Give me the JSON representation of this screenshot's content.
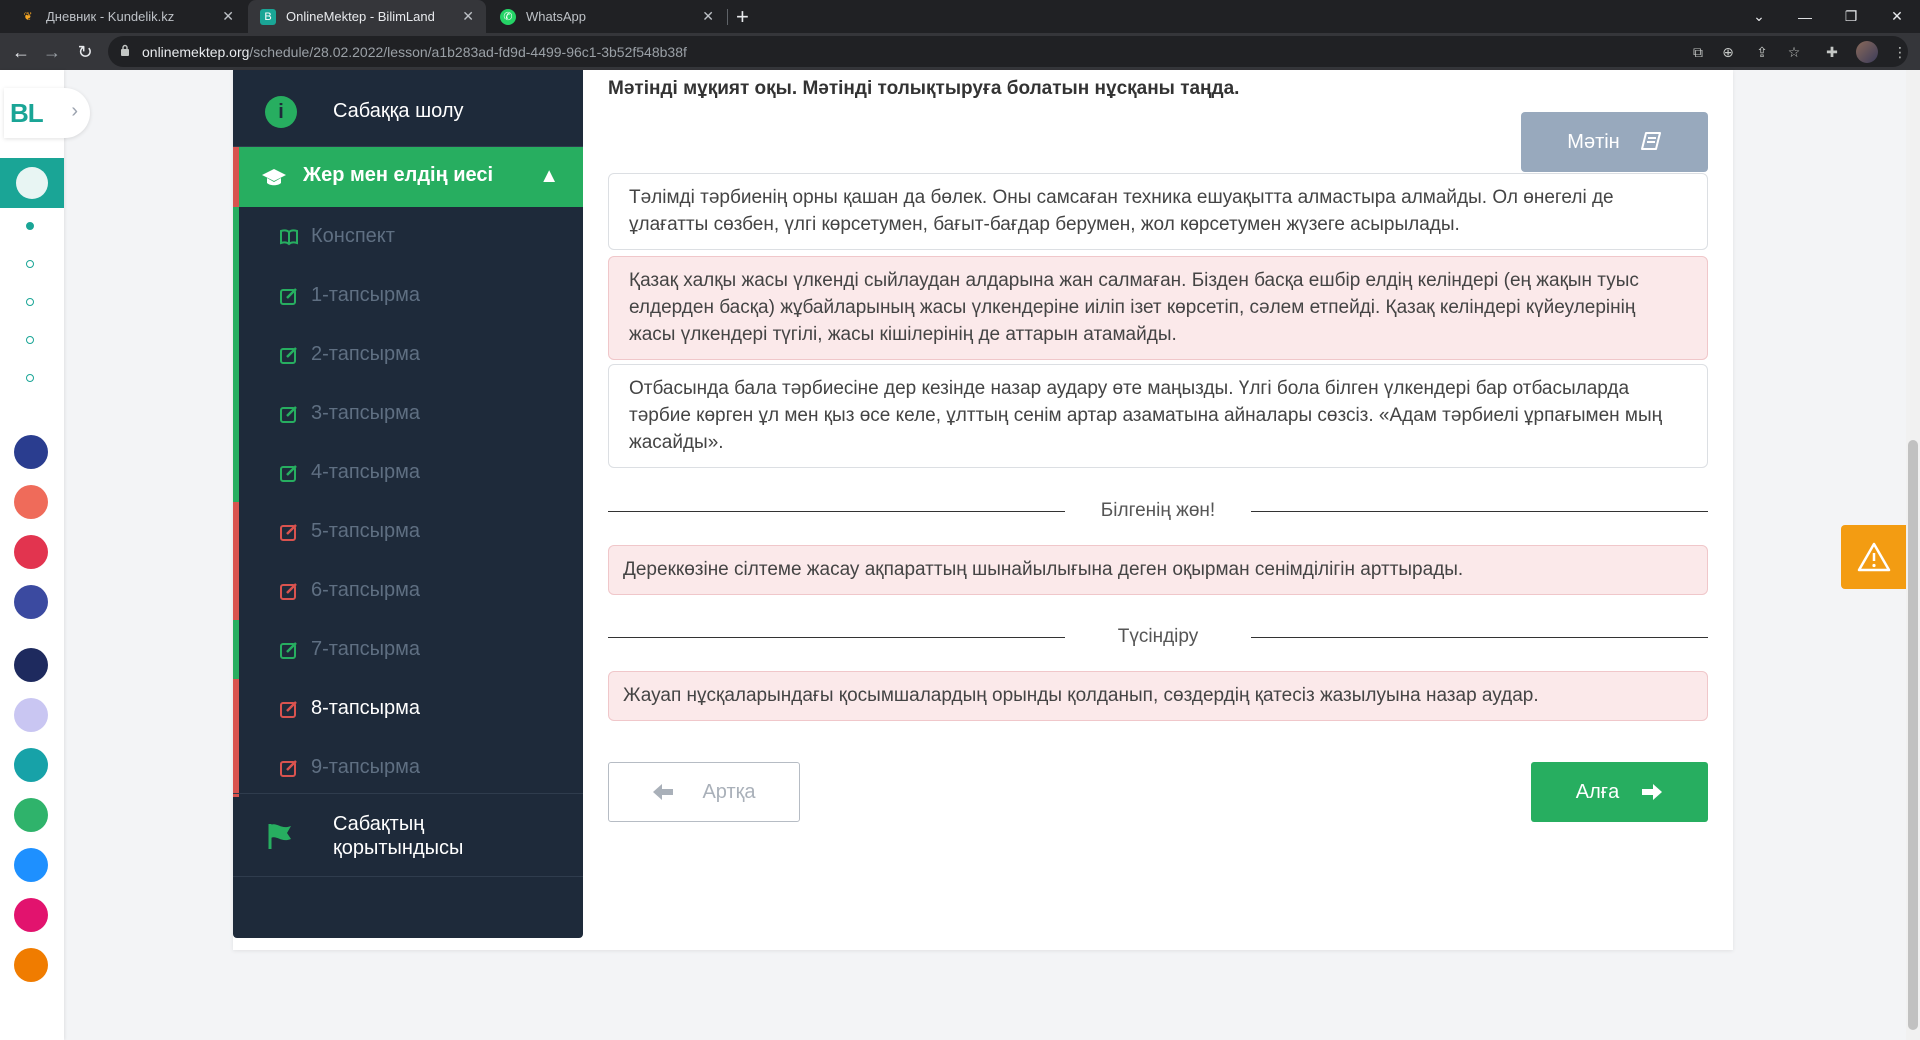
{
  "browser": {
    "tabs": [
      {
        "title": "Дневник - Kundelik.kz"
      },
      {
        "title": "OnlineMektep - BilimLand"
      },
      {
        "title": "WhatsApp"
      }
    ],
    "url_host": "onlinemektep.org",
    "url_path": "/schedule/28.02.2022/lesson/a1b283ad-fd9d-4499-96c1-3b52f548b38f"
  },
  "brand": {
    "logo": "BL",
    "accent": "#1aa596"
  },
  "lesson_nav": {
    "overview": "Сабаққа шолу",
    "section": "Жер мен елдің иесі",
    "items": [
      {
        "label": "Конспект",
        "status": "book"
      },
      {
        "label": "1-тапсырма",
        "status": "done"
      },
      {
        "label": "2-тапсырма",
        "status": "done"
      },
      {
        "label": "3-тапсырма",
        "status": "done"
      },
      {
        "label": "4-тапсырма",
        "status": "done"
      },
      {
        "label": "5-тапсырма",
        "status": "wrong"
      },
      {
        "label": "6-тапсырма",
        "status": "wrong"
      },
      {
        "label": "7-тапсырма",
        "status": "done"
      },
      {
        "label": "8-тапсырма",
        "status": "current"
      },
      {
        "label": "9-тапсырма",
        "status": "wrong"
      }
    ],
    "summary": "Сабақтың қорытындысы"
  },
  "main": {
    "instruction": "Мәтінді мұқият оқы. Мәтінді толықтыруға болатын нұсқаны таңда.",
    "text_button": "Мәтін",
    "options": [
      "Тәлімді тәрбиенің орны қашан да бөлек. Оны самсаған техника ешуақытта алмастыра алмайды. Ол өнегелі де ұлағатты сөзбен, үлгі көрсетумен, бағыт-бағдар берумен, жол көрсетумен жүзеге асырылады.",
      "Қазақ халқы жасы үлкенді сыйлаудан алдарына жан салмаған. Бізден басқа ешбір елдің келіндері (ең жақын туыс елдерден басқа) жұбайларының жасы үлкендеріне иіліп ізет көрсетіп, сәлем етпейді. Қазақ келіндері күйеулерінің жасы үлкендері түгілі, жасы кішілерінің де аттарын атамайды.",
      "Отбасында бала тәрбиесіне дер кезінде назар аудару өте маңызды. Үлгі бола білген үлкендері бар отбасыларда тәрбие көрген ұл мен қыз өсе келе, ұлттың сенім артар азаматына айналары сөзсіз. «Адам тәрбиелі ұрпағымен мың жасайды»."
    ],
    "know_title": "Білгенің жөн!",
    "know_text": "Дереккөзіне сілтеме жасау ақпараттың шынайылығына деген оқырман сенімділігін арттырады.",
    "explain_title": "Түсіндіру",
    "explain_text": "Жауап нұсқаларындағы қосымшалардың орынды қолданып, сөздердің қатесіз жазылуына назар аудар.",
    "back": "Артқа",
    "next": "Алға"
  },
  "colors": {
    "green": "#27ae60",
    "nav_bg": "#1e2a3a",
    "wrong": "#d9534f",
    "warning": "#f39c12"
  }
}
